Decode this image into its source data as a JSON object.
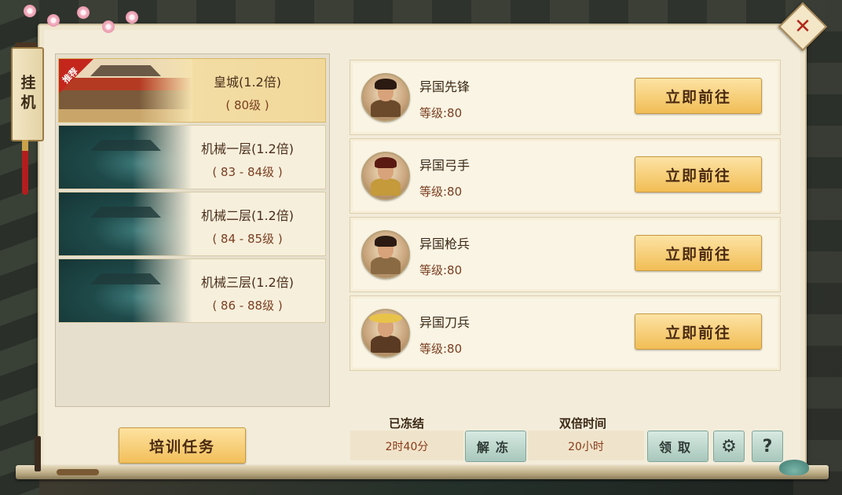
{
  "side_tab": {
    "label": "挂机"
  },
  "maps": [
    {
      "name": "皇城(1.2倍)",
      "level": "( 80级 )",
      "badge": "推荐",
      "selected": true
    },
    {
      "name": "机械一层(1.2倍)",
      "level": "( 83 - 84级 )",
      "selected": false
    },
    {
      "name": "机械二层(1.2倍)",
      "level": "( 84 - 85级 )",
      "selected": false
    },
    {
      "name": "机械三层(1.2倍)",
      "level": "( 86 - 88级 )",
      "selected": false
    }
  ],
  "enemies": [
    {
      "name": "异国先锋",
      "level": "等级:80",
      "button": "立即前往"
    },
    {
      "name": "异国弓手",
      "level": "等级:80",
      "button": "立即前往"
    },
    {
      "name": "异国枪兵",
      "level": "等级:80",
      "button": "立即前往"
    },
    {
      "name": "异国刀兵",
      "level": "等级:80",
      "button": "立即前往"
    }
  ],
  "bottom": {
    "train_button": "培训任务",
    "frozen_label": "已冻结",
    "frozen_value": "2时40分",
    "unfreeze_button": "解冻",
    "double_label": "双倍时间",
    "double_value": "20小时",
    "claim_button": "领取",
    "settings_icon": "gear-icon",
    "help_label": "?"
  },
  "close": {
    "label": "✕"
  },
  "colors": {
    "accent": "#f1bd55",
    "panel": "#f3ecda",
    "close": "#b2261a"
  }
}
